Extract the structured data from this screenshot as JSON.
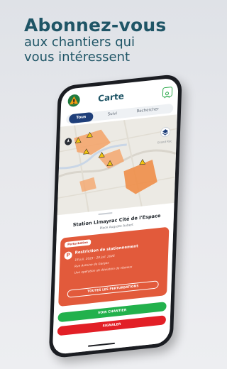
{
  "headline": {
    "title": "Abonnez-vous",
    "line2": "aux chantiers qui",
    "line3": "vous intéressent"
  },
  "app": {
    "screen_title": "Carte",
    "icons": {
      "logo": "roadworks-logo-icon",
      "user": "user-icon",
      "layers": "layers-icon",
      "locate": "locate-icon"
    },
    "tabs": [
      {
        "label": "Tous",
        "active": true
      },
      {
        "label": "Suivi",
        "active": false
      },
      {
        "label": "Rechercher",
        "active": false
      }
    ]
  },
  "map": {
    "labels": [
      "Grand Roc"
    ]
  },
  "site": {
    "name": "Station Limayrac Cité de l'Espace",
    "address": "Place Auguste Aubert"
  },
  "perturbation": {
    "badge": "Perturbation",
    "icon_letter": "P",
    "title": "Restriction de stationnement",
    "dates": "18 juil. 2023 - 29 juil. 2026",
    "street": "Rue Antoine de Gargas",
    "description": "Une opération de déviation de réseaux",
    "all_button": "TOUTES LES PERTURBATIONS"
  },
  "actions": {
    "view": "VOIR CHANTIER",
    "report": "SIGNALER"
  },
  "colors": {
    "headline": "#1f5566",
    "card": "#e25a3b",
    "green": "#22b14c",
    "red": "#e21f26",
    "tab_active": "#1f3f7a"
  }
}
